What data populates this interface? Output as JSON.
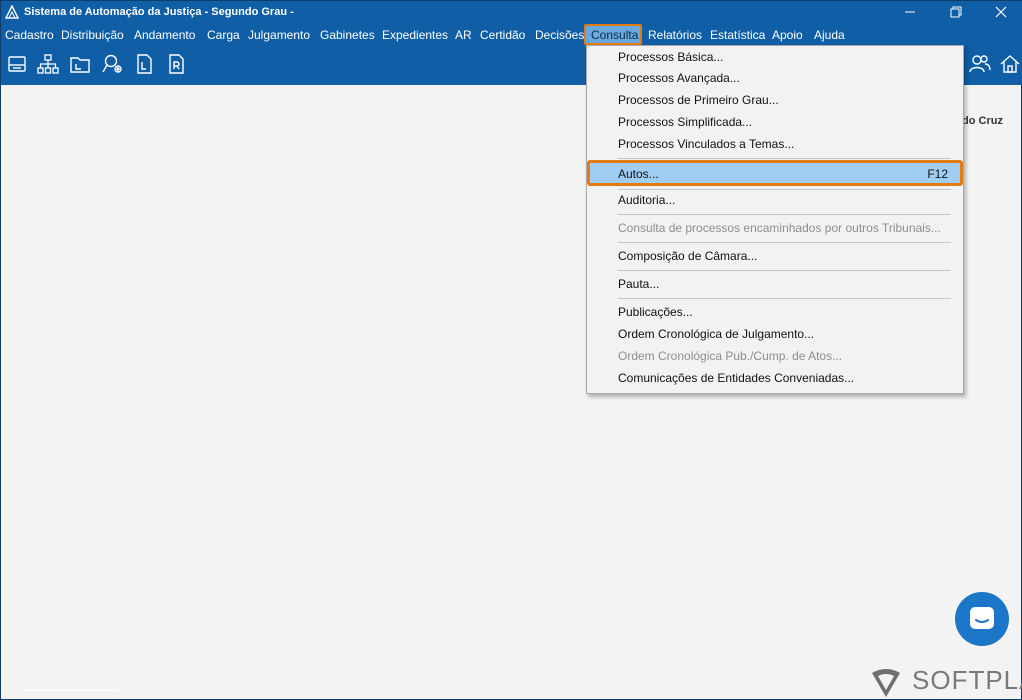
{
  "window": {
    "title": "Sistema de Automação da Justiça - Segundo Grau -"
  },
  "menubar": {
    "items": [
      {
        "label": "Cadastro"
      },
      {
        "label": "Distribuição"
      },
      {
        "label": "Andamento"
      },
      {
        "label": "Carga"
      },
      {
        "label": "Julgamento"
      },
      {
        "label": "Gabinetes"
      },
      {
        "label": "Expedientes"
      },
      {
        "label": "AR"
      },
      {
        "label": "Certidão"
      },
      {
        "label": "Decisões"
      },
      {
        "label": "Consulta"
      },
      {
        "label": "Relatórios"
      },
      {
        "label": "Estatística"
      },
      {
        "label": "Apoio"
      },
      {
        "label": "Ajuda"
      }
    ],
    "active": "Consulta"
  },
  "toolbar": {
    "icons": [
      "printer-icon",
      "org-tree-icon",
      "folder-icon",
      "search-user-icon",
      "document-l-icon",
      "document-r-icon",
      "users-icon",
      "home-icon"
    ]
  },
  "content": {
    "user_label": "do Cruz"
  },
  "dropdown": {
    "items": [
      {
        "label": "Processos Básica...",
        "enabled": true
      },
      {
        "label": "Processos Avançada...",
        "enabled": true
      },
      {
        "label": "Processos de Primeiro Grau...",
        "enabled": true
      },
      {
        "label": "Processos Simplificada...",
        "enabled": true
      },
      {
        "label": "Processos Vinculados a Temas...",
        "enabled": true
      },
      {
        "label": "Autos...",
        "shortcut": "F12",
        "enabled": true,
        "highlighted": true
      },
      {
        "label": "Auditoria...",
        "enabled": true
      },
      {
        "label": "Consulta de processos encaminhados por outros Tribunais...",
        "enabled": false
      },
      {
        "label": "Composição de Câmara...",
        "enabled": true
      },
      {
        "label": "Pauta...",
        "enabled": true
      },
      {
        "label": "Publicações...",
        "enabled": true
      },
      {
        "label": "Ordem Cronológica de Julgamento...",
        "enabled": true
      },
      {
        "label": "Ordem Cronológica Pub./Cump. de Atos...",
        "enabled": false
      },
      {
        "label": "Comunicações de Entidades Conveniadas...",
        "enabled": true
      }
    ]
  },
  "brand": {
    "name": "SOFTPLAN"
  },
  "colors": {
    "titlebar": "#0f5ea6",
    "highlight_border": "#e27b12",
    "highlight_fill": "#9fcdf3",
    "chat_button": "#1b76c8"
  }
}
